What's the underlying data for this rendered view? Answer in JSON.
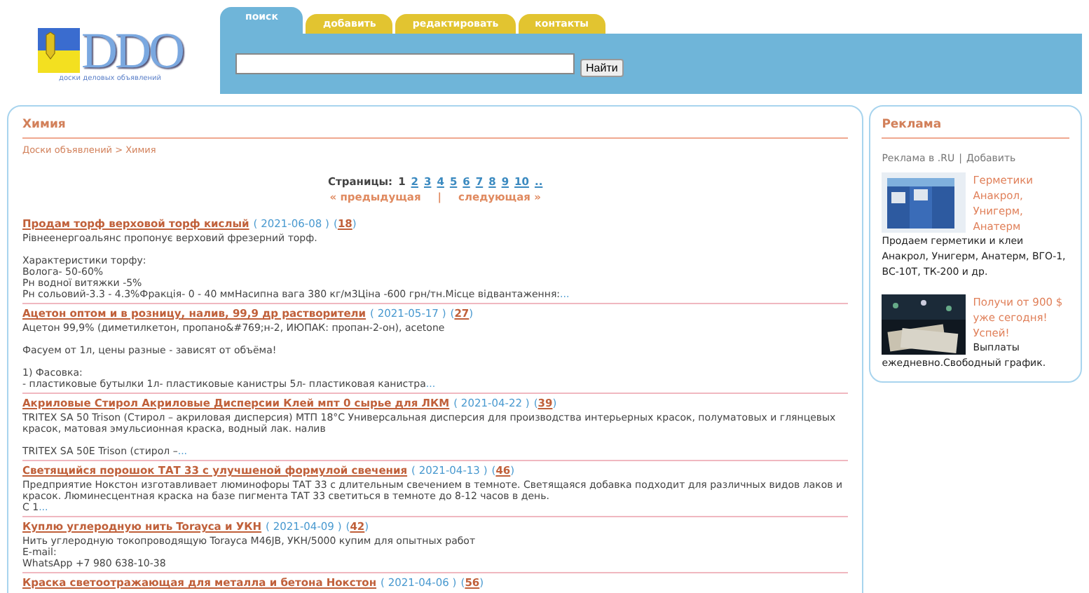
{
  "logo": {
    "mark": "DDO",
    "tagline": "доски деловых объявлений"
  },
  "tabs": [
    {
      "label": "поиск",
      "selected": true
    },
    {
      "label": "добавить",
      "selected": false
    },
    {
      "label": "редактировать",
      "selected": false
    },
    {
      "label": "контакты",
      "selected": false
    }
  ],
  "search": {
    "button": "Найти"
  },
  "main": {
    "title": "Химия",
    "breadcrumb": "Доски объявлений > Химия",
    "pagination": {
      "label": "Страницы:",
      "pages": [
        {
          "label": "1",
          "selected": true
        },
        {
          "label": "2",
          "selected": false
        },
        {
          "label": "3",
          "selected": false
        },
        {
          "label": "4",
          "selected": false
        },
        {
          "label": "5",
          "selected": false
        },
        {
          "label": "6",
          "selected": false
        },
        {
          "label": "7",
          "selected": false
        },
        {
          "label": "8",
          "selected": false
        },
        {
          "label": "9",
          "selected": false
        },
        {
          "label": "10",
          "selected": false
        },
        {
          "label": "..",
          "selected": false
        }
      ],
      "prev": "« предыдущая",
      "separator": "|",
      "next": "следующая »"
    },
    "listings": [
      {
        "title": "Продам торф верховой торф кислый",
        "date": "( 2021-06-08 )",
        "count": "18",
        "paragraphs": [
          [
            "Рівнеенергоальянс пропонує верховий фрезерний торф."
          ],
          [
            "Характеристики торфу:",
            "Вологa- 50-60%",
            "Рн водної витяжки -5%",
            "Рн сольовий-3.3 - 4.3%Фракція- 0 - 40 ммНасипна вага 380 кг/м3Ціна -600 грн/тн.Місце відвантаження:"
          ]
        ],
        "more": "..."
      },
      {
        "title": "Ацетон оптом и в розницу, налив, 99,9 др растворители",
        "date": "( 2021-05-17 )",
        "count": "27",
        "paragraphs": [
          [
            "Ацетон 99,9% (диметилкетон, пропано&#769;н-2, ИЮПАК: пропан-2-он), acetone"
          ],
          [
            "Фасуем от 1л, цены разные - зависят от объёма!"
          ],
          [
            "1) Фасовка:",
            "- пластиковые бутылки 1л- пластиковые канистры 5л- пластиковая канистра"
          ]
        ],
        "more": "..."
      },
      {
        "title": "Акриловые Стирол Акриловые Дисперсии Клей мпт 0 сырье для ЛКМ",
        "date": "( 2021-04-22 )",
        "count": "39",
        "paragraphs": [
          [
            "TRITEX SA 50 Trison (Стирол – акриловая дисперсия) МТП 18°C Универсальная дисперсия для производства интерьерных красок, полуматовых и глянцевых красок, матовая эмульсионная краска, водный лак. налив"
          ],
          [
            "TRITEX SA 50E Trison (стирол –"
          ]
        ],
        "more": "..."
      },
      {
        "title": "Светящийся порошок ТАТ 33 с улучшеной формулой свечения",
        "date": "( 2021-04-13 )",
        "count": "46",
        "paragraphs": [
          [
            "Предприятие Нокстон изготавливает люминофоры ТАТ 33 с длительным свечением в темноте. Светящаяся добавка подходит для различных видов лаков и красок. Люминесцентная краска на базе пигмента ТАТ 33 светиться в темноте до 8-12 часов в день.",
            "С 1"
          ]
        ],
        "more": "..."
      },
      {
        "title": "Куплю углеродную нить Torayca и УКН",
        "date": "( 2021-04-09 )",
        "count": "42",
        "paragraphs": [
          [
            "Нить углеродную токопроводящую Torayca M46JB, УКН/5000 купим для опытных работ",
            "E-mail:",
            "WhatsApp +7 980 638-10-38"
          ]
        ]
      },
      {
        "title": "Краска светоотражающая для металла и бетона Нокстон",
        "date": "( 2021-04-06 )",
        "count": "56"
      }
    ],
    "count_brackets": [
      "(",
      ")"
    ]
  },
  "sidebar": {
    "title": "Реклама",
    "links": [
      "Реклама в .RU",
      "|",
      "Добавить"
    ],
    "ads": [
      {
        "kind": "picture",
        "title": "Герметики Анакрол, Унигерм, Анатерм",
        "text": "Продаем герметики и клеи Анакрол, Унигерм, Анатерм, ВГО-1, ВС-10Т, ТК-200 и др."
      },
      {
        "kind": "picture",
        "title": "Получи от 900 $ уже сегодня! Успей!",
        "text": "Выплаты ежедневно.Свободный график."
      }
    ]
  }
}
